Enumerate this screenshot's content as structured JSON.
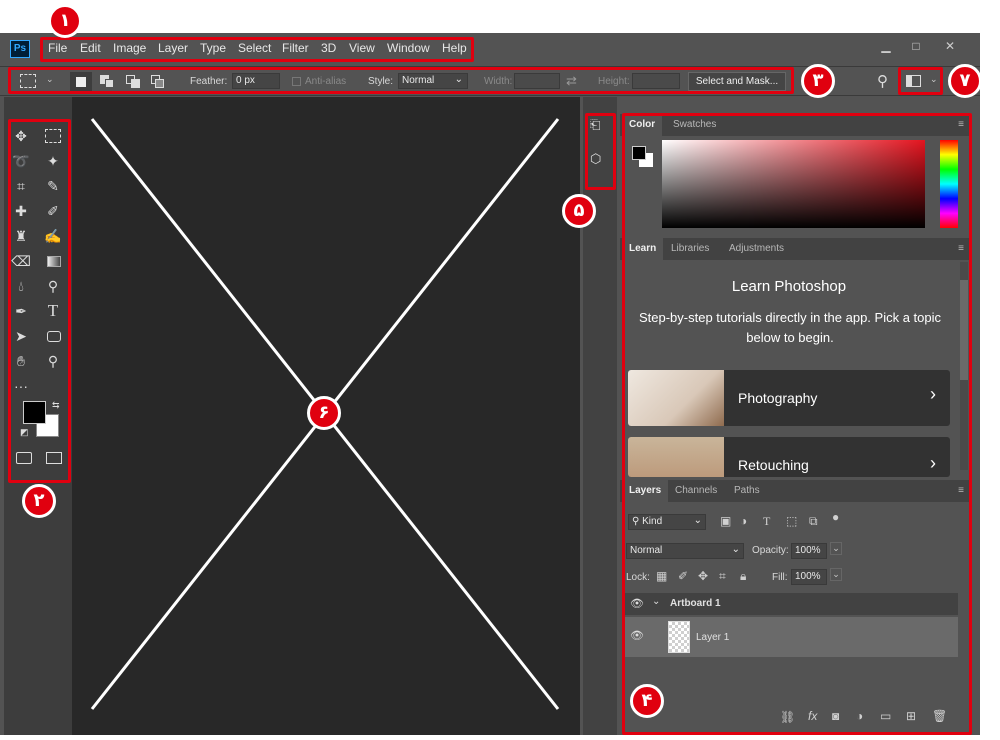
{
  "app": {
    "logo": "Ps"
  },
  "menu": [
    "File",
    "Edit",
    "Image",
    "Layer",
    "Type",
    "Select",
    "Filter",
    "3D",
    "View",
    "Window",
    "Help"
  ],
  "window_controls": [
    "minimize-icon",
    "maximize-icon",
    "close-icon"
  ],
  "options": {
    "feather_label": "Feather:",
    "feather_value": "0 px",
    "antialias_label": "Anti-alias",
    "style_label": "Style:",
    "style_value": "Normal",
    "width_label": "Width:",
    "height_label": "Height:",
    "select_mask": "Select and Mask..."
  },
  "color_panel": {
    "tabs": [
      "Color",
      "Swatches"
    ],
    "accent": "#e0000f"
  },
  "learn_panel": {
    "tabs": [
      "Learn",
      "Libraries",
      "Adjustments"
    ],
    "title": "Learn Photoshop",
    "subtitle": "Step-by-step tutorials directly in the app. Pick a topic below to begin.",
    "cards": [
      "Photography",
      "Retouching"
    ]
  },
  "layers_panel": {
    "tabs": [
      "Layers",
      "Channels",
      "Paths"
    ],
    "kind": "Kind",
    "blend_mode": "Normal",
    "opacity_label": "Opacity:",
    "opacity_value": "100%",
    "lock_label": "Lock:",
    "fill_label": "Fill:",
    "fill_value": "100%",
    "artboard_name": "Artboard 1",
    "layer_name": "Layer 1"
  },
  "badges": {
    "b1": "١",
    "b2": "٢",
    "b3": "٣",
    "b4": "۴",
    "b5": "۵",
    "b6": "۶",
    "b7": "٧"
  }
}
